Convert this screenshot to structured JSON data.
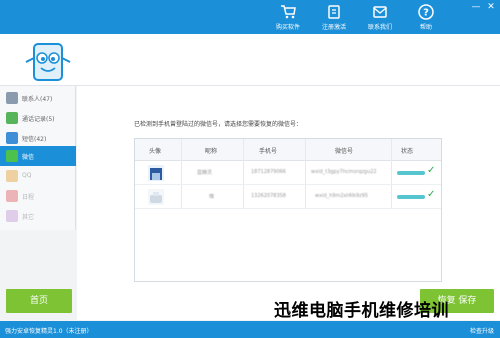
{
  "colors": {
    "accent": "#1b8fd8",
    "green": "#7dc334",
    "check": "#2aa84a"
  },
  "topbar": {
    "buttons": [
      {
        "label": "购买软件",
        "icon": "cart-icon"
      },
      {
        "label": "注册激活",
        "icon": "key-icon"
      },
      {
        "label": "联系我们",
        "icon": "contact-icon"
      },
      {
        "label": "帮助",
        "icon": "help-icon"
      }
    ],
    "window_controls": [
      "—",
      "✕"
    ]
  },
  "sidebar": {
    "items": [
      {
        "label": "联系人(47)",
        "icon": "contacts-icon",
        "color": "#8a9bb0"
      },
      {
        "label": "通话记录(5)",
        "icon": "phone-icon",
        "color": "#58b45a"
      },
      {
        "label": "短信(42)",
        "icon": "sms-icon",
        "color": "#3e8fd6"
      },
      {
        "label": "微信",
        "icon": "wechat-icon",
        "color": "#4cc24c"
      },
      {
        "label": "QQ",
        "icon": "qq-icon",
        "color": "#e6a13b"
      },
      {
        "label": "日程",
        "icon": "calendar-icon",
        "color": "#e06464"
      },
      {
        "label": "其它",
        "icon": "apps-icon",
        "color": "#c59ad6"
      }
    ]
  },
  "main": {
    "instruction": "已检测到手机曾登陆过的微信号，请选择您需要恢复的微信号：",
    "table": {
      "headers": [
        "头像",
        "昵称",
        "手机号",
        "微信号",
        "状态"
      ],
      "rows": [
        {
          "nickname": "蓝精灵",
          "phone": "18712879066",
          "wechat_id": "wxid_t3gpy7hcmsrqzgu22"
        },
        {
          "nickname": "噢",
          "phone": "13262078358",
          "wechat_id": "wxid_h9m2xt4lk9z95"
        }
      ]
    }
  },
  "buttons": {
    "home": "首页",
    "next": "恢复  保存"
  },
  "status": {
    "left": "强力安卓恢复精灵1.0（未注册）",
    "right": "检查升级"
  },
  "watermark": "迅维电脑手机维修培训"
}
